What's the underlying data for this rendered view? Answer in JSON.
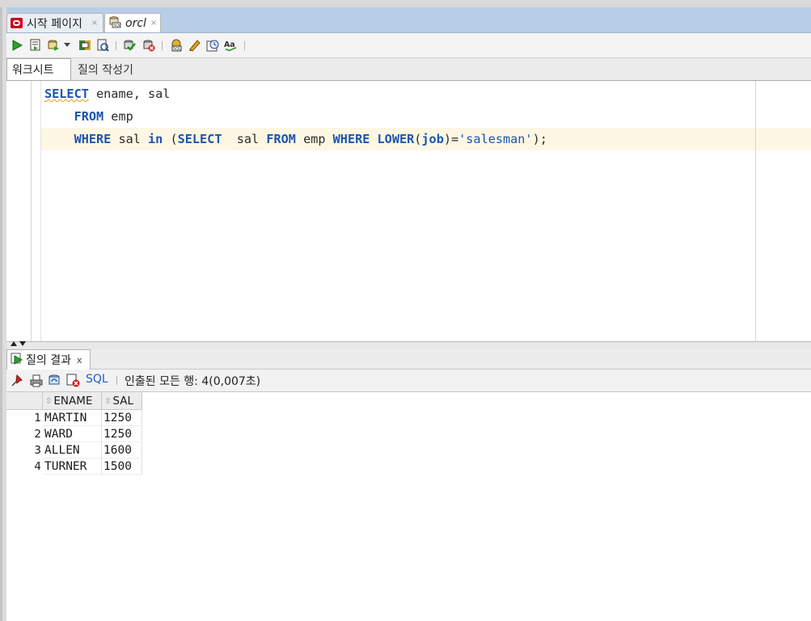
{
  "tabs": [
    {
      "label": "시작 페이지",
      "close": "×",
      "icon": "oracle-logo-icon"
    },
    {
      "label": "orcl",
      "close": "×",
      "icon": "sql-connection-icon"
    }
  ],
  "toolbar": {
    "icons": [
      "run-statement-icon",
      "run-script-icon",
      "commit-icon",
      "dropdown-arrow-icon",
      "explain-plan-icon",
      "autotrace-icon",
      "commit-transaction-icon",
      "rollback-icon",
      "sql-tuning-icon",
      "clear-icon",
      "history-icon",
      "format-icon"
    ]
  },
  "subtabs": {
    "worksheet": "워크시트",
    "query_builder": "질의 작성기"
  },
  "editor": {
    "line1": {
      "kw1": "SELECT",
      "rest": " ename, sal"
    },
    "line2": {
      "indent": "    ",
      "kw1": "FROM",
      "rest": " emp"
    },
    "line3": {
      "indent": "    ",
      "kw1": "WHERE",
      "t1": " sal ",
      "kw2": "in",
      "t2": " (",
      "kw3": "SELECT",
      "t3": "  sal ",
      "kw4": "FROM",
      "t4": " emp ",
      "kw5": "WHERE",
      "t5": " ",
      "kw6": "LOWER",
      "t6": "(",
      "kw7": "job",
      "t7": ")=",
      "str": "'salesman'",
      "t8": ");"
    }
  },
  "results": {
    "tab_label": "질의 결과",
    "tab_close": "x",
    "sql_link": "SQL",
    "fetch_status": "인출된 모든 행: 4(0,007초)",
    "columns": [
      "ENAME",
      "SAL"
    ],
    "rows": [
      {
        "num": "1",
        "ename": "MARTIN",
        "sal": "1250"
      },
      {
        "num": "2",
        "ename": "WARD",
        "sal": "1250"
      },
      {
        "num": "3",
        "ename": "ALLEN",
        "sal": "1600"
      },
      {
        "num": "4",
        "ename": "TURNER",
        "sal": "1500"
      }
    ]
  },
  "colors": {
    "tab_bar": "#b8cde6",
    "keyword": "#1c55b0",
    "current_line": "#fdf7e3"
  }
}
